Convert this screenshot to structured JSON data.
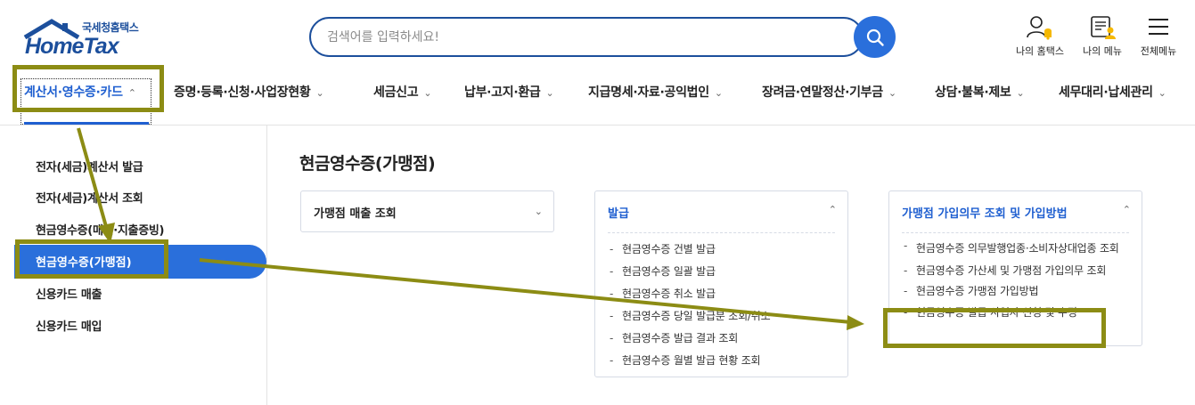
{
  "logo": {
    "sub": "국세청홈택스",
    "main": "HomeTax"
  },
  "search": {
    "placeholder": "검색어를 입력하세요!"
  },
  "utility": [
    {
      "label": "나의 홈택스",
      "icon": "user-bell-icon"
    },
    {
      "label": "나의 메뉴",
      "icon": "document-user-icon"
    },
    {
      "label": "전체메뉴",
      "icon": "hamburger-icon"
    }
  ],
  "gnb": [
    {
      "label": "계산서·영수증·카드",
      "chevron": "⌃"
    },
    {
      "label": "증명·등록·신청·사업장현황",
      "chevron": "⌄"
    },
    {
      "label": "세금신고",
      "chevron": "⌄"
    },
    {
      "label": "납부·고지·환급",
      "chevron": "⌄"
    },
    {
      "label": "지급명세·자료·공익법인",
      "chevron": "⌄"
    },
    {
      "label": "장려금·연말정산·기부금",
      "chevron": "⌄"
    },
    {
      "label": "상담·불복·제보",
      "chevron": "⌄"
    },
    {
      "label": "세무대리·납세관리",
      "chevron": "⌄"
    }
  ],
  "sidebar": {
    "items": [
      "전자(세금)계산서 발급",
      "전자(세금)계산서 조회",
      "현금영수증(매입·지출증빙)",
      "현금영수증(가맹점)",
      "신용카드 매출",
      "신용카드 매입"
    ]
  },
  "main": {
    "title": "현금영수증(가맹점)",
    "cards": [
      {
        "title": "가맹점 매출 조회",
        "expanded": false,
        "chevron": "⌄",
        "items": []
      },
      {
        "title": "발급",
        "expanded": true,
        "chevron": "⌃",
        "items": [
          "현금영수증 건별 발급",
          "현금영수증 일괄 발급",
          "현금영수증 취소 발급",
          "현금영수증 당일 발급분 조회/취소",
          "현금영수증 발급 결과 조회",
          "현금영수증 월별 발급 현황 조회"
        ]
      },
      {
        "title": "가맹점 가입의무 조회 및 가입방법",
        "expanded": true,
        "chevron": "⌃",
        "items": [
          "현금영수증 의무발행업종·소비자상대업종 조회",
          "현금영수증 가산세 및 가맹점 가입의무 조회",
          "현금영수증 가맹점 가입방법",
          "현금영수증 발급 사업자 신청 및 수정"
        ]
      }
    ]
  },
  "colors": {
    "brand": "#1c4f9c",
    "accent": "#2a6fdb",
    "annotation": "#8c8c14"
  }
}
